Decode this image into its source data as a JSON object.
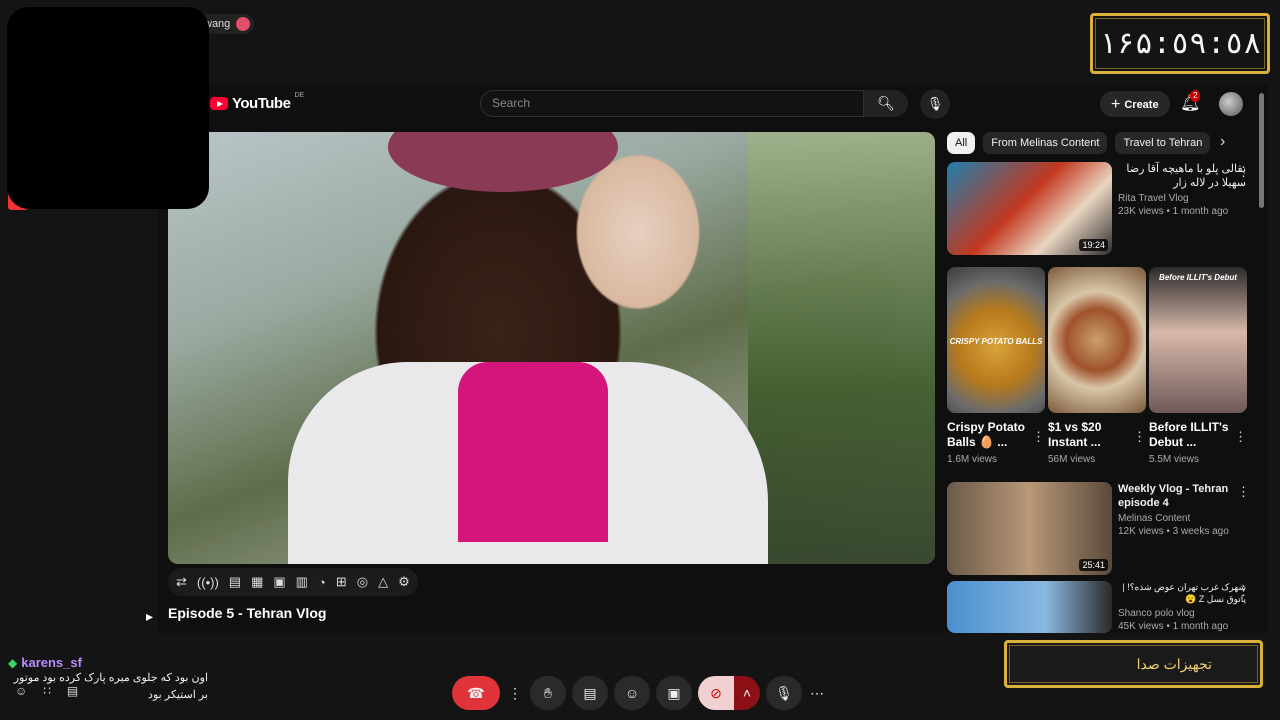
{
  "overlay": {
    "username": "wang",
    "clock": "۱۶۵:٥٩:٥٨",
    "audio_settings": "تجهیزات صدا"
  },
  "youtube": {
    "logo": "YouTube",
    "region": "DE",
    "search_placeholder": "Search",
    "create_label": "Create",
    "notification_count": "2",
    "chips": [
      "All",
      "From Melinas Content",
      "Travel to Tehran"
    ],
    "video_title": "Episode 5 - Tehran Vlog",
    "recommendations": [
      {
        "title": "بقالی پلو با ماهیچه آقا رضا سهیلا در لاله زار",
        "channel": "Rita Travel Vlog",
        "meta": "23K views • 1 month ago",
        "duration": "19:24"
      },
      {
        "title": "Weekly Vlog - Tehran episode 4",
        "channel": "Melinas Content",
        "meta": "12K views • 3 weeks ago",
        "duration": "25:41"
      },
      {
        "title": "شهرک غرب تهران عوض شده؟! | پاتوق نسل Z 😮",
        "channel": "Shanco polo vlog",
        "meta": "45K views • 1 month ago",
        "duration": ""
      }
    ],
    "shorts": [
      {
        "title": "Crispy Potato Balls 🥚 ...",
        "views": "1.6M views",
        "caption": "CRISPY POTATO BALLS"
      },
      {
        "title": "$1 vs $20 Instant ...",
        "views": "56M views",
        "caption": ""
      },
      {
        "title": "Before ILLIT's Debut ...",
        "views": "5.5M views",
        "caption": "Before ILLIT's Debut"
      }
    ]
  },
  "chat": {
    "user": "karens_sf",
    "message": "اون بود که جلوی میره پارک کرده بود موتور بر استیکر بود"
  },
  "colors": {
    "accent_gold": "#d9b03a",
    "end_call": "#e0333a",
    "youtube_red": "#ff0033"
  }
}
